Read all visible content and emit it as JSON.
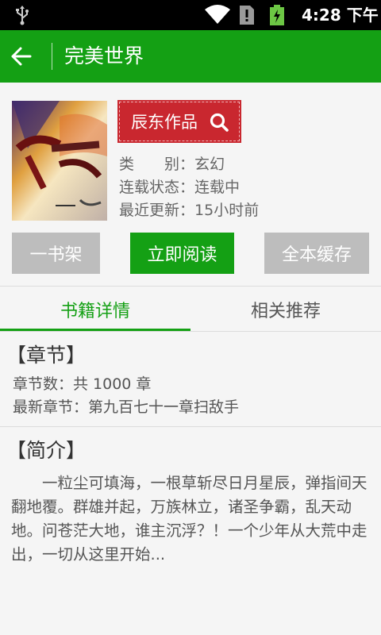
{
  "status_bar": {
    "time": "4:28 下午",
    "icons": [
      "usb-icon",
      "wifi-icon",
      "warning-icon",
      "battery-charging-icon"
    ]
  },
  "app_bar": {
    "title": "完美世界",
    "back_icon": "back-arrow-icon"
  },
  "book": {
    "cover_icon": "book-cover-image",
    "author_button": "辰东作品",
    "author_icon": "search-icon",
    "category_label": "类　　别：",
    "category_value": "玄幻",
    "status_label": "连载状态：",
    "status_value": "连载中",
    "updated_label": "最近更新：",
    "updated_value": "15小时前"
  },
  "actions": {
    "shelf": "一书架",
    "read": "立即阅读",
    "cache": "全本缓存"
  },
  "tabs": [
    {
      "label": "书籍详情",
      "active": true
    },
    {
      "label": "相关推荐",
      "active": false
    }
  ],
  "chapters": {
    "title": "【章节】",
    "count": "章节数：共 1000 章",
    "latest": "最新章节：第九百七十一章扫敌手"
  },
  "intro": {
    "title": "【简介】",
    "text": "一粒尘可填海，一根草斩尽日月星辰，弹指间天翻地覆。群雄并起，万族林立，诸圣争霸，乱天动地。问苍茫大地，谁主沉浮？！一个少年从大荒中走出，一切从这里开始..."
  },
  "colors": {
    "primary_green": "#14a014",
    "author_red": "#c9272f",
    "disabled_gray": "#bdbdbd"
  }
}
